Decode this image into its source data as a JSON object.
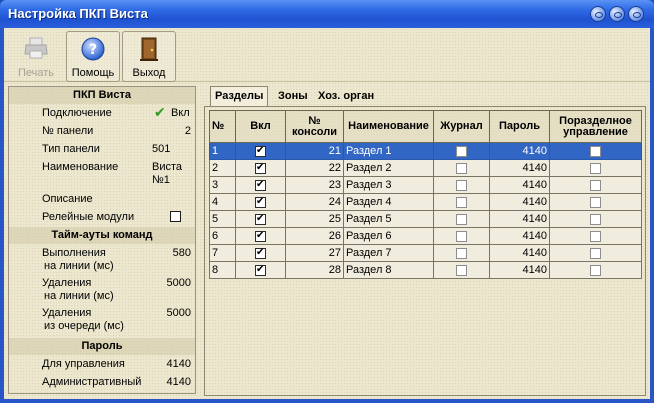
{
  "window": {
    "title": "Настройка ПКП Виста"
  },
  "toolbar": {
    "print_label": "Печать",
    "help_label": "Помощь",
    "exit_label": "Выход"
  },
  "left": {
    "pkp_title": "ПКП Виста",
    "connection_label": "Подключение",
    "connection_value": "Вкл",
    "panel_no_label": "№ панели",
    "panel_no_value": "2",
    "panel_type_label": "Тип панели",
    "panel_type_value": "501",
    "name_label": "Наименование",
    "name_value_1": "Виста",
    "name_value_2": "№1",
    "description_label": "Описание",
    "relay_label": "Релейные модули",
    "timeouts_title": "Тайм-ауты команд",
    "exec_label_1": "Выполнения",
    "exec_label_2": "на линии (мс)",
    "exec_value": "580",
    "del_line_label_1": "Удаления",
    "del_line_label_2": "на линии (мс)",
    "del_line_value": "5000",
    "del_queue_label_1": "Удаления",
    "del_queue_label_2": "из очереди (мс)",
    "del_queue_value": "5000",
    "password_title": "Пароль",
    "control_label": "Для управления",
    "control_value": "4140",
    "admin_label": "Административный",
    "admin_value": "4140"
  },
  "tabs": [
    "Разделы",
    "Зоны",
    "Хоз. орган"
  ],
  "grid": {
    "headers": [
      "№",
      "Вкл",
      "№ консоли",
      "Наименование",
      "Журнал",
      "Пароль",
      "Поразделное управление"
    ],
    "header_console_1": "№",
    "header_console_2": "консоли",
    "header_split_1": "Поразделное",
    "header_split_2": "управление",
    "rows": [
      {
        "n": "1",
        "console": "21",
        "name": "Раздел 1",
        "password": "4140"
      },
      {
        "n": "2",
        "console": "22",
        "name": "Раздел 2",
        "password": "4140"
      },
      {
        "n": "3",
        "console": "23",
        "name": "Раздел 3",
        "password": "4140"
      },
      {
        "n": "4",
        "console": "24",
        "name": "Раздел 4",
        "password": "4140"
      },
      {
        "n": "5",
        "console": "25",
        "name": "Раздел 5",
        "password": "4140"
      },
      {
        "n": "6",
        "console": "26",
        "name": "Раздел 6",
        "password": "4140"
      },
      {
        "n": "7",
        "console": "27",
        "name": "Раздел 7",
        "password": "4140"
      },
      {
        "n": "8",
        "console": "28",
        "name": "Раздел 8",
        "password": "4140"
      }
    ]
  },
  "colors": {
    "selection": "#3166c5",
    "titlebar": "#2f6ae6",
    "check": "#2e9a1e"
  }
}
